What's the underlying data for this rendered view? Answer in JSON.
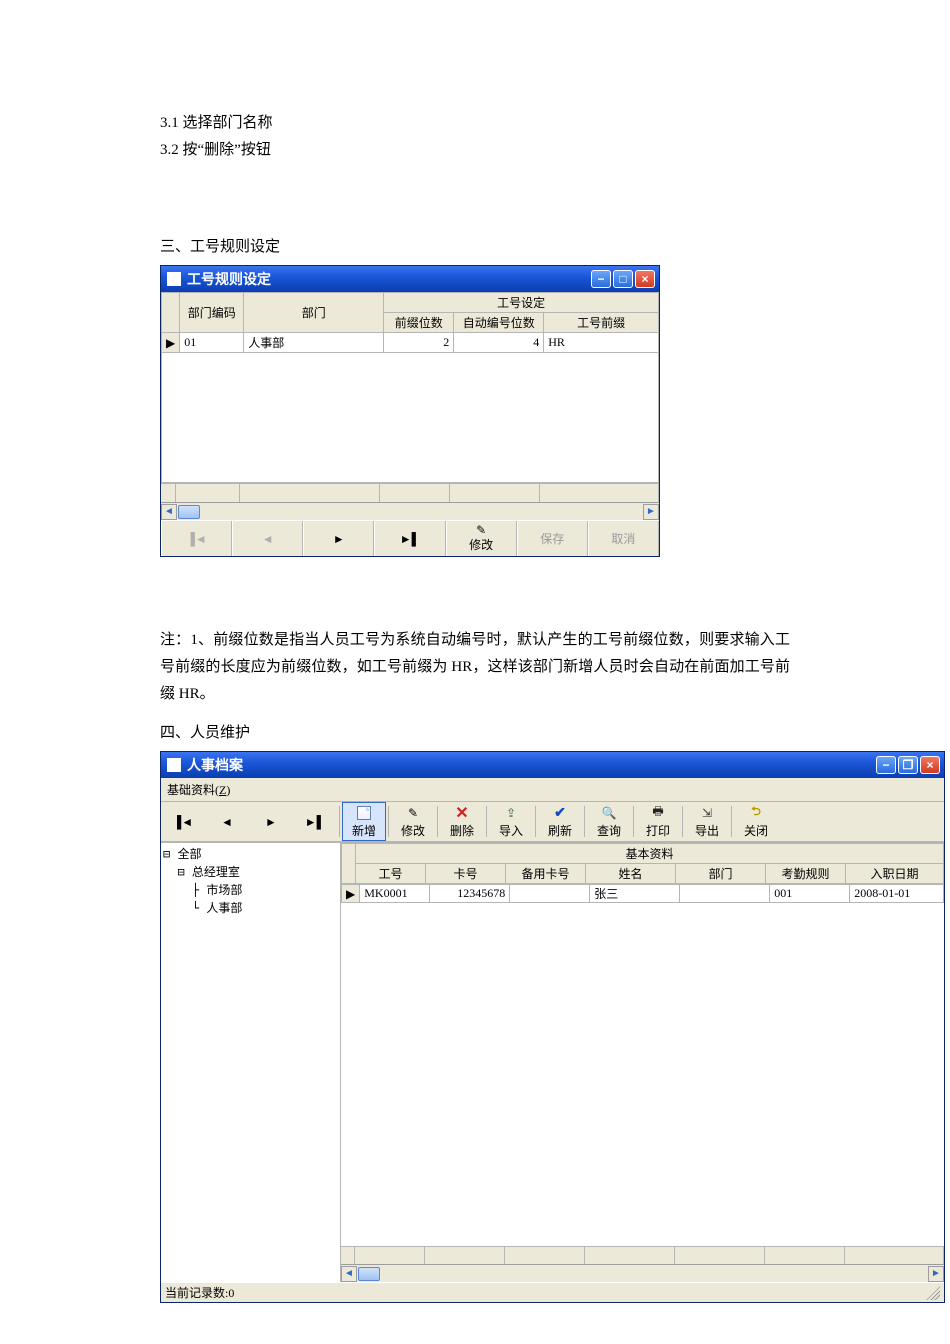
{
  "doc": {
    "line1": "3.1  选择部门名称",
    "line2": "3.2  按“删除”按钮",
    "h3": "三、工号规则设定",
    "note": "注：1、前缀位数是指当人员工号为系统自动编号时，默认产生的工号前缀位数，则要求输入工号前缀的长度应为前缀位数，如工号前缀为 HR，这样该部门新增人员时会自动在前面加工号前缀 HR。",
    "h4": "四、人员维护"
  },
  "win1": {
    "title": "工号规则设定",
    "header_group": "工号设定",
    "cols": {
      "dept_code": "部门编码",
      "dept": "部门",
      "prefix_len": "前缀位数",
      "auto_len": "自动编号位数",
      "prefix": "工号前缀"
    },
    "row": {
      "dept_code": "01",
      "dept": "人事部",
      "prefix_len": "2",
      "auto_len": "4",
      "prefix": "HR"
    },
    "nav": {
      "first": "",
      "prev": "",
      "next": "",
      "last": "",
      "edit": "修改",
      "save": "保存",
      "cancel": "取消"
    }
  },
  "win2": {
    "title": "人事档案",
    "menu": "基础资料(Z)",
    "toolbar": {
      "first": "",
      "prev": "",
      "next": "",
      "last": "",
      "new": "新增",
      "edit": "修改",
      "del": "删除",
      "import": "导入",
      "refresh": "刷新",
      "query": "查询",
      "print": "打印",
      "export": "导出",
      "close": "关闭"
    },
    "tree": {
      "root": "全部",
      "n1": "总经理室",
      "n1a": "市场部",
      "n1b": "人事部"
    },
    "grid": {
      "group": "基本资料",
      "cols": {
        "empno": "工号",
        "cardno": "卡号",
        "bak_cardno": "备用卡号",
        "name": "姓名",
        "dept": "部门",
        "att_rule": "考勤规则",
        "hiredate": "入职日期"
      },
      "row": {
        "empno": "MK0001",
        "cardno": "12345678",
        "bak_cardno": "",
        "name": "张三",
        "dept": "",
        "att_rule": "001",
        "hiredate": "2008-01-01"
      }
    },
    "status": "当前记录数:0"
  }
}
